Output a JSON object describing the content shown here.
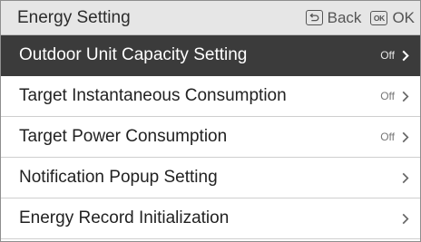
{
  "header": {
    "title": "Energy Setting",
    "back_label": "Back",
    "ok_label": "OK",
    "ok_icon_text": "OK"
  },
  "menu": {
    "items": [
      {
        "label": "Outdoor Unit Capacity Setting",
        "value": "Off",
        "selected": true
      },
      {
        "label": "Target Instantaneous Consumption",
        "value": "Off",
        "selected": false
      },
      {
        "label": "Target Power Consumption",
        "value": "Off",
        "selected": false
      },
      {
        "label": "Notification Popup Setting",
        "value": "",
        "selected": false
      },
      {
        "label": "Energy Record Initialization",
        "value": "",
        "selected": false
      }
    ]
  },
  "colors": {
    "header_bg": "#e6e6e6",
    "selected_bg": "#3b3b3b",
    "selected_text": "#ffffff"
  }
}
